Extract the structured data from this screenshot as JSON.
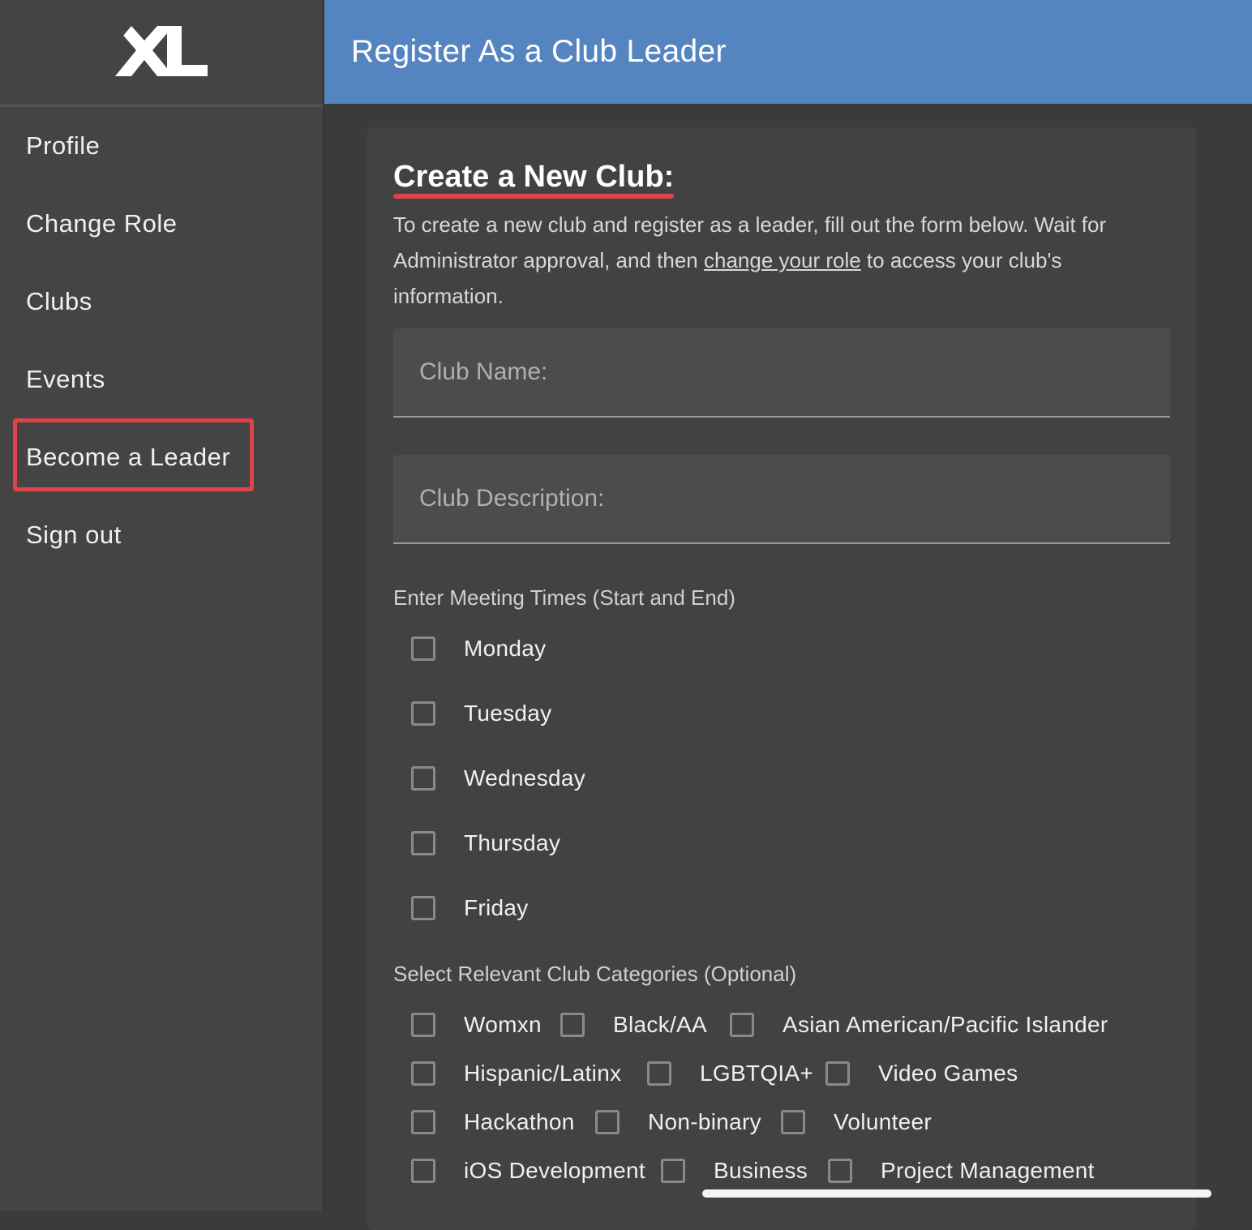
{
  "sidebar": {
    "logo_text": "XL",
    "items": [
      {
        "label": "Profile"
      },
      {
        "label": "Change Role"
      },
      {
        "label": "Clubs"
      },
      {
        "label": "Events"
      },
      {
        "label": "Become a Leader"
      },
      {
        "label": "Sign out"
      }
    ]
  },
  "header": {
    "title": "Register As a Club Leader"
  },
  "form": {
    "title": "Create a New Club:",
    "intro_before": "To create a new club and register as a leader, fill out the form below. Wait for Administrator approval, and then ",
    "intro_link": "change your role",
    "intro_after": " to access your club's information.",
    "club_name_placeholder": "Club Name:",
    "club_description_placeholder": "Club Description:",
    "meeting_label": "Enter Meeting Times (Start and End)",
    "days": [
      "Monday",
      "Tuesday",
      "Wednesday",
      "Thursday",
      "Friday"
    ],
    "categories_label": "Select Relevant Club Categories (Optional)",
    "categories": [
      "Womxn",
      "Black/AA",
      "Asian American/Pacific Islander",
      "Hispanic/Latinx",
      "LGBTQIA+",
      "Video Games",
      "Hackathon",
      "Non-binary",
      "Volunteer",
      "iOS Development",
      "Business",
      "Project Management"
    ]
  },
  "colors": {
    "accent_red": "#e0424d",
    "header_blue": "#5585c1",
    "background": "#3b3b3b"
  }
}
